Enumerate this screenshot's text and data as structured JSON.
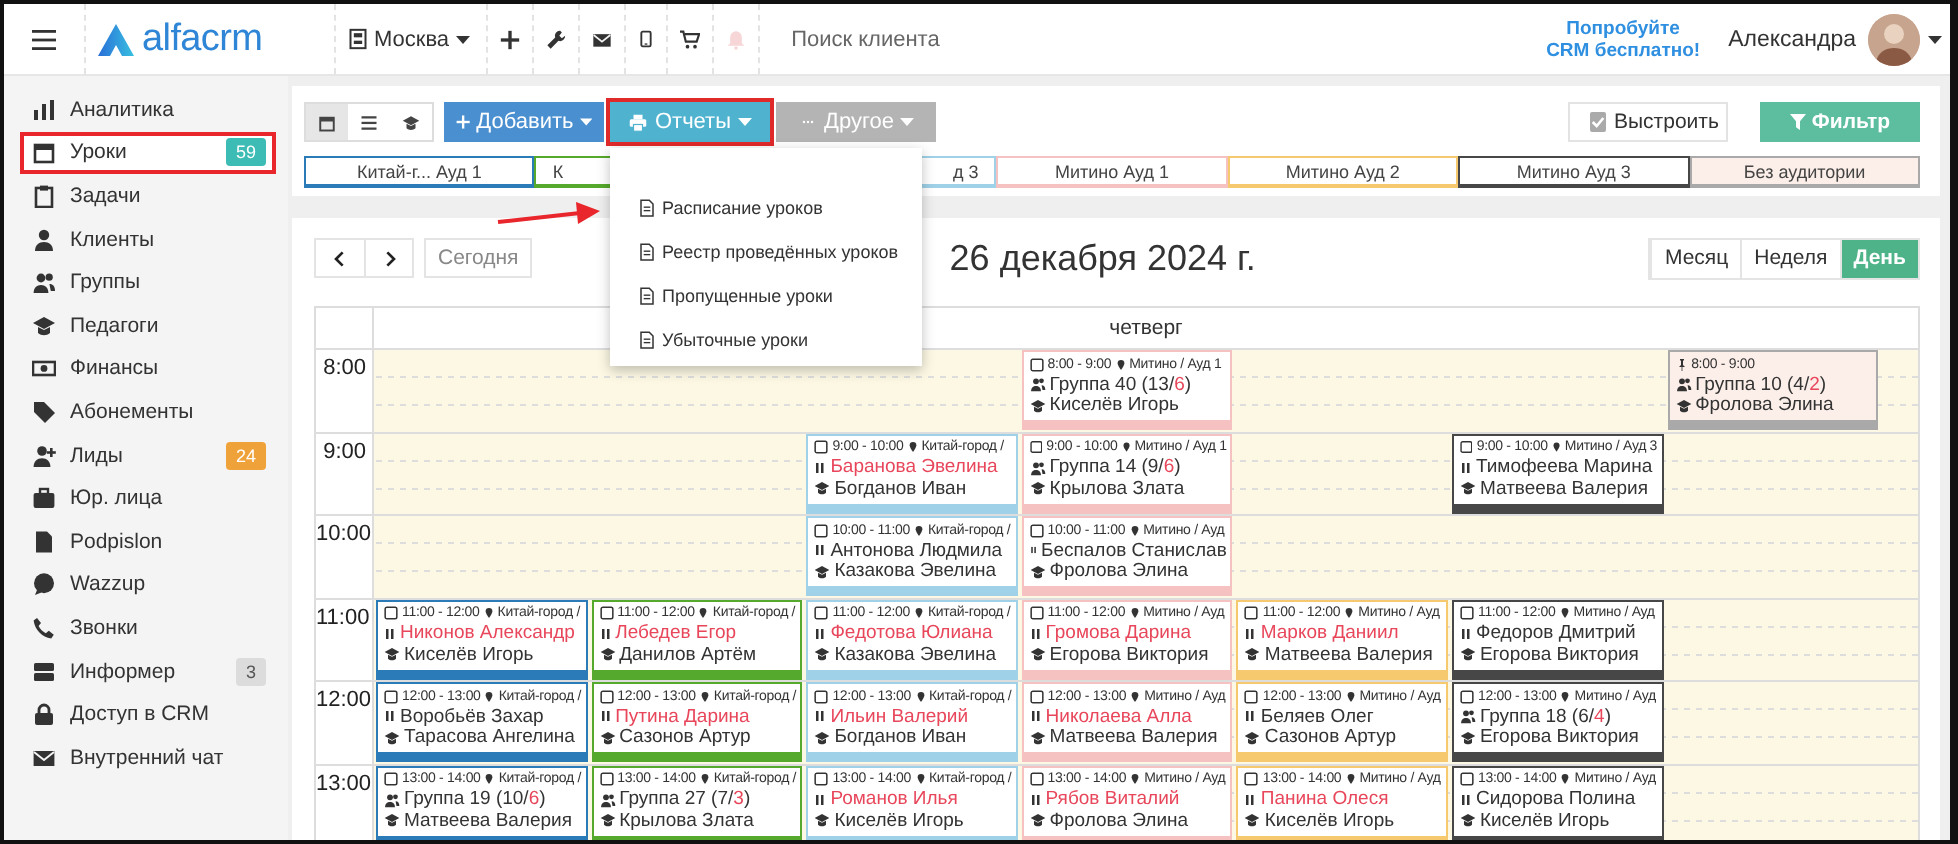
{
  "header": {
    "logo": "alfacrm",
    "city": "Москва",
    "search": {
      "placeholder": "Поиск клиента"
    },
    "promo": [
      "Попробуйте",
      "CRM бесплатно!"
    ],
    "user": "Александра"
  },
  "sidebar": {
    "items": [
      {
        "label": "Аналитика",
        "highlighted": false
      },
      {
        "label": "Уроки",
        "highlighted": true,
        "badge": {
          "text": "59",
          "color": "#3cbcb4"
        }
      },
      {
        "label": "Задачи",
        "highlighted": false
      },
      {
        "label": "Клиенты",
        "highlighted": false
      },
      {
        "label": "Группы",
        "highlighted": false
      },
      {
        "label": "Педагоги",
        "highlighted": false
      },
      {
        "label": "Финансы",
        "highlighted": false
      },
      {
        "label": "Абонементы",
        "highlighted": false
      },
      {
        "label": "Лиды",
        "highlighted": false,
        "badge": {
          "text": "24",
          "color": "#f0a23a"
        }
      },
      {
        "label": "Юр. лица",
        "highlighted": false
      },
      {
        "label": "Podpislon",
        "highlighted": false
      },
      {
        "label": "Wazzup",
        "highlighted": false
      },
      {
        "label": "Звонки",
        "highlighted": false
      },
      {
        "label": "Информер",
        "highlighted": false,
        "badge": {
          "text": "3",
          "color": "#dcdcdc"
        }
      },
      {
        "label": "Доступ в CRM",
        "highlighted": false
      },
      {
        "label": "Внутренний чат",
        "highlighted": false
      }
    ]
  },
  "toolbar": {
    "view_buttons": [
      {
        "selected": true
      },
      {
        "selected": false
      },
      {
        "selected": false
      }
    ],
    "actions": [
      {
        "label": "Добавить",
        "kind": "primary",
        "highlighted": false,
        "disabled": false
      },
      {
        "label": "Отчеты",
        "kind": "info",
        "highlighted": true,
        "disabled": false,
        "menu": [
          {
            "label": "Расписание уроков"
          },
          {
            "label": "Реестр проведённых уроков"
          },
          {
            "label": "Пропущенные уроки"
          },
          {
            "label": "Убыточные уроки"
          }
        ]
      },
      {
        "label": "Другое",
        "kind": "default",
        "highlighted": false,
        "disabled": true
      }
    ],
    "arrange": {
      "label": "Выстроить",
      "checked": true
    },
    "filter": {
      "label": "Фильтр"
    }
  },
  "rooms": [
    {
      "label": "Китай-г... Ауд 1",
      "color": "#2b7bb9",
      "kind": "room"
    },
    {
      "label": "К",
      "color": "#55a92c",
      "kind": "room"
    },
    {
      "label": "д 3",
      "color": "#9fd1e8",
      "kind": "room"
    },
    {
      "label": "Митино Ауд 1",
      "color": "#f5c1c1",
      "kind": "room"
    },
    {
      "label": "Митино Ауд 2",
      "color": "#f6c96e",
      "kind": "room"
    },
    {
      "label": "Митино Ауд 3",
      "color": "#474747",
      "kind": "room"
    },
    {
      "label": "Без аудитории",
      "color": "#a9a9a9",
      "kind": "unassigned"
    }
  ],
  "calendar": {
    "today": "Сегодня",
    "title": "26 декабря 2024 г.",
    "views": [
      {
        "label": "Месяц",
        "selected": false
      },
      {
        "label": "Неделя",
        "selected": false
      },
      {
        "label": "День",
        "selected": true
      }
    ],
    "day": "четверг",
    "hours": [
      {
        "time": "8:00",
        "cells": [
          {
            "kind": "empty"
          },
          {
            "kind": "empty"
          },
          {
            "kind": "empty"
          },
          {
            "kind": "event",
            "marker": {
              "kind": "checkbox"
            },
            "time": "8:00 - 9:00",
            "place": "Митино / Ауд 1",
            "title": {
              "kind": "group",
              "parts": [
                {
                  "text": "Группа 40 (13/",
                  "alert": false
                },
                {
                  "text": "6",
                  "alert": true
                },
                {
                  "text": ")",
                  "alert": false
                }
              ]
            },
            "teacher": "Киселёв Игорь"
          },
          {
            "kind": "empty"
          },
          {
            "kind": "empty"
          },
          {
            "kind": "event",
            "marker": {
              "kind": "pin"
            },
            "time": "8:00 - 9:00",
            "title": {
              "kind": "group",
              "parts": [
                {
                  "text": "Группа 10 (4/",
                  "alert": false
                },
                {
                  "text": "2",
                  "alert": true
                },
                {
                  "text": ")",
                  "alert": false
                }
              ]
            },
            "teacher": "Фролова Элина"
          }
        ]
      },
      {
        "time": "9:00",
        "cells": [
          {
            "kind": "empty"
          },
          {
            "kind": "empty"
          },
          {
            "kind": "event",
            "marker": {
              "kind": "checkbox"
            },
            "time": "9:00 - 10:00",
            "place": "Китай-город /",
            "title": {
              "kind": "individual",
              "parts": [
                {
                  "text": "Баранова Эвелина",
                  "alert": true
                }
              ]
            },
            "teacher": "Богданов Иван"
          },
          {
            "kind": "event",
            "marker": {
              "kind": "checkbox"
            },
            "time": "9:00 - 10:00",
            "place": "Митино / Ауд 1",
            "title": {
              "kind": "group",
              "parts": [
                {
                  "text": "Группа 14 (9/",
                  "alert": false
                },
                {
                  "text": "6",
                  "alert": true
                },
                {
                  "text": ")",
                  "alert": false
                }
              ]
            },
            "teacher": "Крылова Злата"
          },
          {
            "kind": "empty"
          },
          {
            "kind": "event",
            "marker": {
              "kind": "checkbox"
            },
            "time": "9:00 - 10:00",
            "place": "Митино / Ауд 3",
            "title": {
              "kind": "individual",
              "parts": [
                {
                  "text": "Тимофеева Марина",
                  "alert": false
                }
              ]
            },
            "teacher": "Матвеева Валерия"
          },
          {
            "kind": "empty"
          }
        ]
      },
      {
        "time": "10:00",
        "cells": [
          {
            "kind": "empty"
          },
          {
            "kind": "empty"
          },
          {
            "kind": "event",
            "marker": {
              "kind": "checkbox"
            },
            "time": "10:00 - 11:00",
            "place": "Китай-город /",
            "title": {
              "kind": "individual",
              "parts": [
                {
                  "text": "Антонова Людмила",
                  "alert": false
                }
              ]
            },
            "teacher": "Казакова Эвелина"
          },
          {
            "kind": "event",
            "marker": {
              "kind": "checkbox"
            },
            "time": "10:00 - 11:00",
            "place": "Митино / Ауд",
            "title": {
              "kind": "individual",
              "parts": [
                {
                  "text": "Беспалов Станислав",
                  "alert": false
                }
              ]
            },
            "teacher": "Фролова Элина"
          },
          {
            "kind": "empty"
          },
          {
            "kind": "empty"
          },
          {
            "kind": "empty"
          }
        ]
      },
      {
        "time": "11:00",
        "cells": [
          {
            "kind": "event",
            "marker": {
              "kind": "checkbox"
            },
            "time": "11:00 - 12:00",
            "place": "Китай-город /",
            "title": {
              "kind": "individual",
              "parts": [
                {
                  "text": "Никонов Александр",
                  "alert": true
                }
              ]
            },
            "teacher": "Киселёв Игорь"
          },
          {
            "kind": "event",
            "marker": {
              "kind": "checkbox"
            },
            "time": "11:00 - 12:00",
            "place": "Китай-город /",
            "title": {
              "kind": "individual",
              "parts": [
                {
                  "text": "Лебедев Егор",
                  "alert": true
                }
              ]
            },
            "teacher": "Данилов Артём"
          },
          {
            "kind": "event",
            "marker": {
              "kind": "checkbox"
            },
            "time": "11:00 - 12:00",
            "place": "Китай-город /",
            "title": {
              "kind": "individual",
              "parts": [
                {
                  "text": "Федотова Юлиана",
                  "alert": true
                }
              ]
            },
            "teacher": "Казакова Эвелина"
          },
          {
            "kind": "event",
            "marker": {
              "kind": "checkbox"
            },
            "time": "11:00 - 12:00",
            "place": "Митино / Ауд",
            "title": {
              "kind": "individual",
              "parts": [
                {
                  "text": "Громова Дарина",
                  "alert": true
                }
              ]
            },
            "teacher": "Егорова Виктория"
          },
          {
            "kind": "event",
            "marker": {
              "kind": "checkbox"
            },
            "time": "11:00 - 12:00",
            "place": "Митино / Ауд",
            "title": {
              "kind": "individual",
              "parts": [
                {
                  "text": "Марков Даниил",
                  "alert": true
                }
              ]
            },
            "teacher": "Матвеева Валерия"
          },
          {
            "kind": "event",
            "marker": {
              "kind": "checkbox"
            },
            "time": "11:00 - 12:00",
            "place": "Митино / Ауд",
            "title": {
              "kind": "individual",
              "parts": [
                {
                  "text": "Федоров Дмитрий",
                  "alert": false
                }
              ]
            },
            "teacher": "Егорова Виктория"
          },
          {
            "kind": "empty"
          }
        ]
      },
      {
        "time": "12:00",
        "cells": [
          {
            "kind": "event",
            "marker": {
              "kind": "checkbox"
            },
            "time": "12:00 - 13:00",
            "place": "Китай-город /",
            "title": {
              "kind": "individual",
              "parts": [
                {
                  "text": "Воробьёв Захар",
                  "alert": false
                }
              ]
            },
            "teacher": "Тарасова Ангелина"
          },
          {
            "kind": "event",
            "marker": {
              "kind": "checkbox"
            },
            "time": "12:00 - 13:00",
            "place": "Китай-город /",
            "title": {
              "kind": "individual",
              "parts": [
                {
                  "text": "Путина Дарина",
                  "alert": true
                }
              ]
            },
            "teacher": "Сазонов Артур"
          },
          {
            "kind": "event",
            "marker": {
              "kind": "checkbox"
            },
            "time": "12:00 - 13:00",
            "place": "Китай-город /",
            "title": {
              "kind": "individual",
              "parts": [
                {
                  "text": "Ильин Валерий",
                  "alert": true
                }
              ]
            },
            "teacher": "Богданов Иван"
          },
          {
            "kind": "event",
            "marker": {
              "kind": "checkbox"
            },
            "time": "12:00 - 13:00",
            "place": "Митино / Ауд",
            "title": {
              "kind": "individual",
              "parts": [
                {
                  "text": "Николаева Алла",
                  "alert": true
                }
              ]
            },
            "teacher": "Матвеева Валерия"
          },
          {
            "kind": "event",
            "marker": {
              "kind": "checkbox"
            },
            "time": "12:00 - 13:00",
            "place": "Митино / Ауд",
            "title": {
              "kind": "individual",
              "parts": [
                {
                  "text": "Беляев Олег",
                  "alert": false
                }
              ]
            },
            "teacher": "Сазонов Артур"
          },
          {
            "kind": "event",
            "marker": {
              "kind": "checkbox"
            },
            "time": "12:00 - 13:00",
            "place": "Митино / Ауд",
            "title": {
              "kind": "group",
              "parts": [
                {
                  "text": "Группа 18 (6/",
                  "alert": false
                },
                {
                  "text": "4",
                  "alert": true
                },
                {
                  "text": ")",
                  "alert": false
                }
              ]
            },
            "teacher": "Егорова Виктория"
          },
          {
            "kind": "empty"
          }
        ]
      },
      {
        "time": "13:00",
        "cells": [
          {
            "kind": "event",
            "marker": {
              "kind": "checkbox"
            },
            "time": "13:00 - 14:00",
            "place": "Китай-город /",
            "title": {
              "kind": "group",
              "parts": [
                {
                  "text": "Группа 19 (10/",
                  "alert": false
                },
                {
                  "text": "6",
                  "alert": true
                },
                {
                  "text": ")",
                  "alert": false
                }
              ]
            },
            "teacher": "Матвеева Валерия"
          },
          {
            "kind": "event",
            "marker": {
              "kind": "checkbox"
            },
            "time": "13:00 - 14:00",
            "place": "Китай-город /",
            "title": {
              "kind": "group",
              "parts": [
                {
                  "text": "Группа 27 (7/",
                  "alert": false
                },
                {
                  "text": "3",
                  "alert": true
                },
                {
                  "text": ")",
                  "alert": false
                }
              ]
            },
            "teacher": "Крылова Злата"
          },
          {
            "kind": "event",
            "marker": {
              "kind": "checkbox"
            },
            "time": "13:00 - 14:00",
            "place": "Китай-город /",
            "title": {
              "kind": "individual",
              "parts": [
                {
                  "text": "Романов Илья",
                  "alert": true
                }
              ]
            },
            "teacher": "Киселёв Игорь"
          },
          {
            "kind": "event",
            "marker": {
              "kind": "checkbox"
            },
            "time": "13:00 - 14:00",
            "place": "Митино / Ауд",
            "title": {
              "kind": "individual",
              "parts": [
                {
                  "text": "Рябов Виталий",
                  "alert": true
                }
              ]
            },
            "teacher": "Фролова Элина"
          },
          {
            "kind": "event",
            "marker": {
              "kind": "checkbox"
            },
            "time": "13:00 - 14:00",
            "place": "Митино / Ауд",
            "title": {
              "kind": "individual",
              "parts": [
                {
                  "text": "Панина Олеся",
                  "alert": true
                }
              ]
            },
            "teacher": "Киселёв Игорь"
          },
          {
            "kind": "event",
            "marker": {
              "kind": "checkbox"
            },
            "time": "13:00 - 14:00",
            "place": "Митино / Ауд",
            "title": {
              "kind": "individual",
              "parts": [
                {
                  "text": "Сидорова Полина",
                  "alert": false
                }
              ]
            },
            "teacher": "Киселёв Игорь"
          },
          {
            "kind": "empty"
          }
        ]
      }
    ]
  }
}
